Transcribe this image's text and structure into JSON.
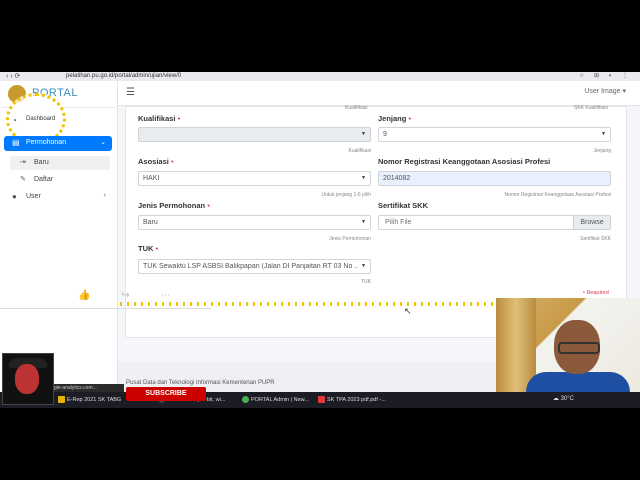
{
  "browser": {
    "url": "pelatihan.pu.go.id/portal/admin/ujian/view/0"
  },
  "brand": {
    "name": "PORTAL"
  },
  "sidebar": {
    "dashboard_label": "Dashboard",
    "dashboard_sub": "",
    "active_menu": "Permohonan",
    "sub_items": [
      "Baru",
      "Daftar"
    ],
    "user_menu": "User"
  },
  "topnav": {
    "user_label": "User Image"
  },
  "form": {
    "top_hints": {
      "left": "Kualifikasi",
      "right": "SKK Kualifikasi"
    },
    "kualifikasi": {
      "label": "Kualifikasi",
      "value": "",
      "hint": "Kualifikasi"
    },
    "jenjang": {
      "label": "Jenjang",
      "value": "9",
      "hint": "Jenjang"
    },
    "asosiasi": {
      "label": "Asosiasi",
      "value": "HAKI",
      "hint": "Untuk jenjang 1-6 pilih"
    },
    "nomor_registrasi": {
      "label": "Nomor Registrasi Keanggotaan Asosiasi Profesi",
      "value": "2014082",
      "hint": "Nomor Registrasi Keanggotaan Asosiasi Profesi"
    },
    "jenis_permohonan": {
      "label": "Jenis Permohonan",
      "value": "Baru",
      "hint": "Jenis Permohonan"
    },
    "sertifikat_skk": {
      "label": "Sertifikat SKK",
      "placeholder": "Pilih File",
      "browse": "Browse",
      "hint": "Sertifikat SKK"
    },
    "tuk": {
      "label": "TUK",
      "value": "TUK Sewaktu LSP ASBSI Balikpapan (Jalan DI Panjaitan RT 03 No ...",
      "hint": "TUK"
    },
    "required_note": "• Required",
    "required_mark": "•"
  },
  "footer": {
    "caption": "Pusat Data dan Teknologi Informasi Kementerian PUPR"
  },
  "overlay": {
    "subscribe": "SUBSCRIBE",
    "ga_text": "gle-analytics.com..."
  },
  "taskbar": {
    "items": [
      "E-Rep 2021 SK TABG",
      "OBS 29.0.2 (64-bit, wi...",
      "PORTAL Admin | New...",
      "SK TPA 2023 pdf.pdf -..."
    ],
    "temperature": "30°C"
  },
  "colors": {
    "accent": "#007bff",
    "required": "#dc3545",
    "brand": "#3c8dbc"
  }
}
